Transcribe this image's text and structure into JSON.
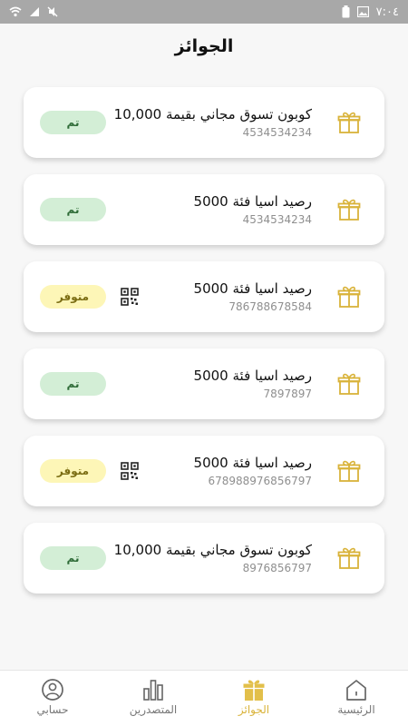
{
  "status_bar": {
    "time": "٧:٠٤"
  },
  "page": {
    "title": "الجوائز"
  },
  "prizes": [
    {
      "title": "كوبون تسوق مجاني بقيمة 10,000",
      "code": "4534534234",
      "status": "تم",
      "status_type": "done",
      "has_qr": false
    },
    {
      "title": "رصيد اسيا فئة 5000",
      "code": "4534534234",
      "status": "تم",
      "status_type": "done",
      "has_qr": false
    },
    {
      "title": "رصيد اسيا فئة 5000",
      "code": "786788678584",
      "status": "متوفر",
      "status_type": "available",
      "has_qr": true
    },
    {
      "title": "رصيد اسيا فئة 5000",
      "code": "7897897",
      "status": "تم",
      "status_type": "done",
      "has_qr": false
    },
    {
      "title": "رصيد اسيا فئة 5000",
      "code": "678988976856797",
      "status": "متوفر",
      "status_type": "available",
      "has_qr": true
    },
    {
      "title": "كوبون تسوق مجاني بقيمة 10,000",
      "code": "8976856797",
      "status": "تم",
      "status_type": "done",
      "has_qr": false
    }
  ],
  "bottom_nav": {
    "items": [
      {
        "label": "حسابي",
        "icon": "user-icon",
        "active": false
      },
      {
        "label": "المتصدرين",
        "icon": "leaderboard-icon",
        "active": false
      },
      {
        "label": "الجوائز",
        "icon": "gift-icon",
        "active": true
      },
      {
        "label": "الرئيسية",
        "icon": "home-icon",
        "active": false
      }
    ]
  },
  "colors": {
    "accent": "#d9b33a",
    "done_bg": "#d3eed6",
    "available_bg": "#fdf6b7",
    "status_bar": "#a8a8a8"
  }
}
